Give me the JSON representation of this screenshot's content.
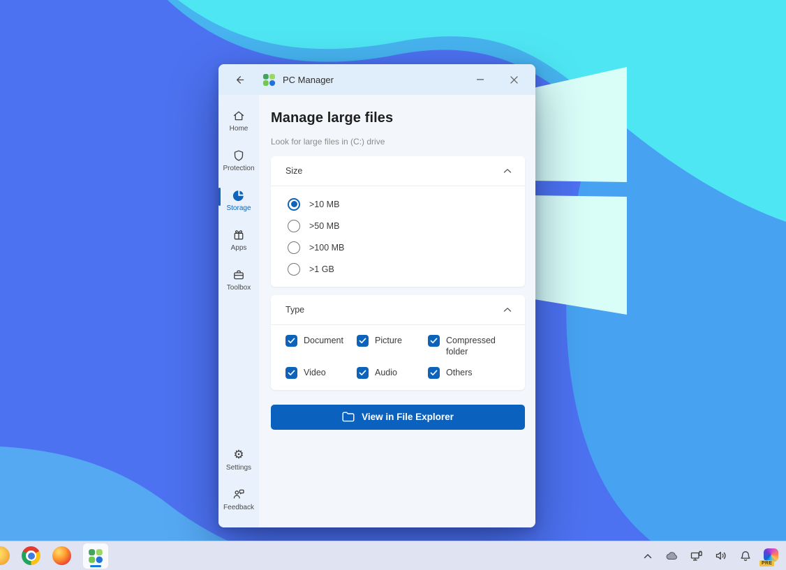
{
  "window": {
    "title": "PC Manager",
    "page": {
      "title": "Manage large files",
      "subtitle": "Look for large files in (C:) drive"
    },
    "sidebar": {
      "items": [
        {
          "label": "Home"
        },
        {
          "label": "Protection"
        },
        {
          "label": "Storage"
        },
        {
          "label": "Apps"
        },
        {
          "label": "Toolbox"
        }
      ],
      "footer_items": [
        {
          "label": "Settings"
        },
        {
          "label": "Feedback"
        }
      ],
      "active_item": "Storage"
    },
    "size_section": {
      "title": "Size",
      "options": [
        {
          "label": ">10 MB",
          "selected": true
        },
        {
          "label": ">50 MB",
          "selected": false
        },
        {
          "label": ">100 MB",
          "selected": false
        },
        {
          "label": ">1 GB",
          "selected": false
        }
      ]
    },
    "type_section": {
      "title": "Type",
      "options": [
        {
          "label": "Document",
          "checked": true
        },
        {
          "label": "Picture",
          "checked": true
        },
        {
          "label": "Compressed folder",
          "checked": true
        },
        {
          "label": "Video",
          "checked": true
        },
        {
          "label": "Audio",
          "checked": true
        },
        {
          "label": "Others",
          "checked": true
        }
      ]
    },
    "action_button": {
      "label": "View in File Explorer"
    }
  },
  "taskbar": {
    "pinned_apps": [
      "partial-app",
      "chrome",
      "firefox",
      "pc-manager"
    ],
    "active_app": "pc-manager",
    "tray_icons": [
      "hidden-icons-chevron",
      "onedrive",
      "network",
      "volume",
      "notifications",
      "copilot"
    ],
    "copilot_badge": "PRE"
  },
  "colors": {
    "accent_blue": "#0b62be",
    "active_blue": "#0f63ba",
    "wallpaper_base": "#4d72f1",
    "wallpaper_cyan": "#4fe6f4",
    "wallpaper_sky": "#47a3f2",
    "wallpaper_pane": "#d9fef8",
    "titlebar_bg": "#e0edfa",
    "sidebar_bg": "#e9f2fc"
  }
}
